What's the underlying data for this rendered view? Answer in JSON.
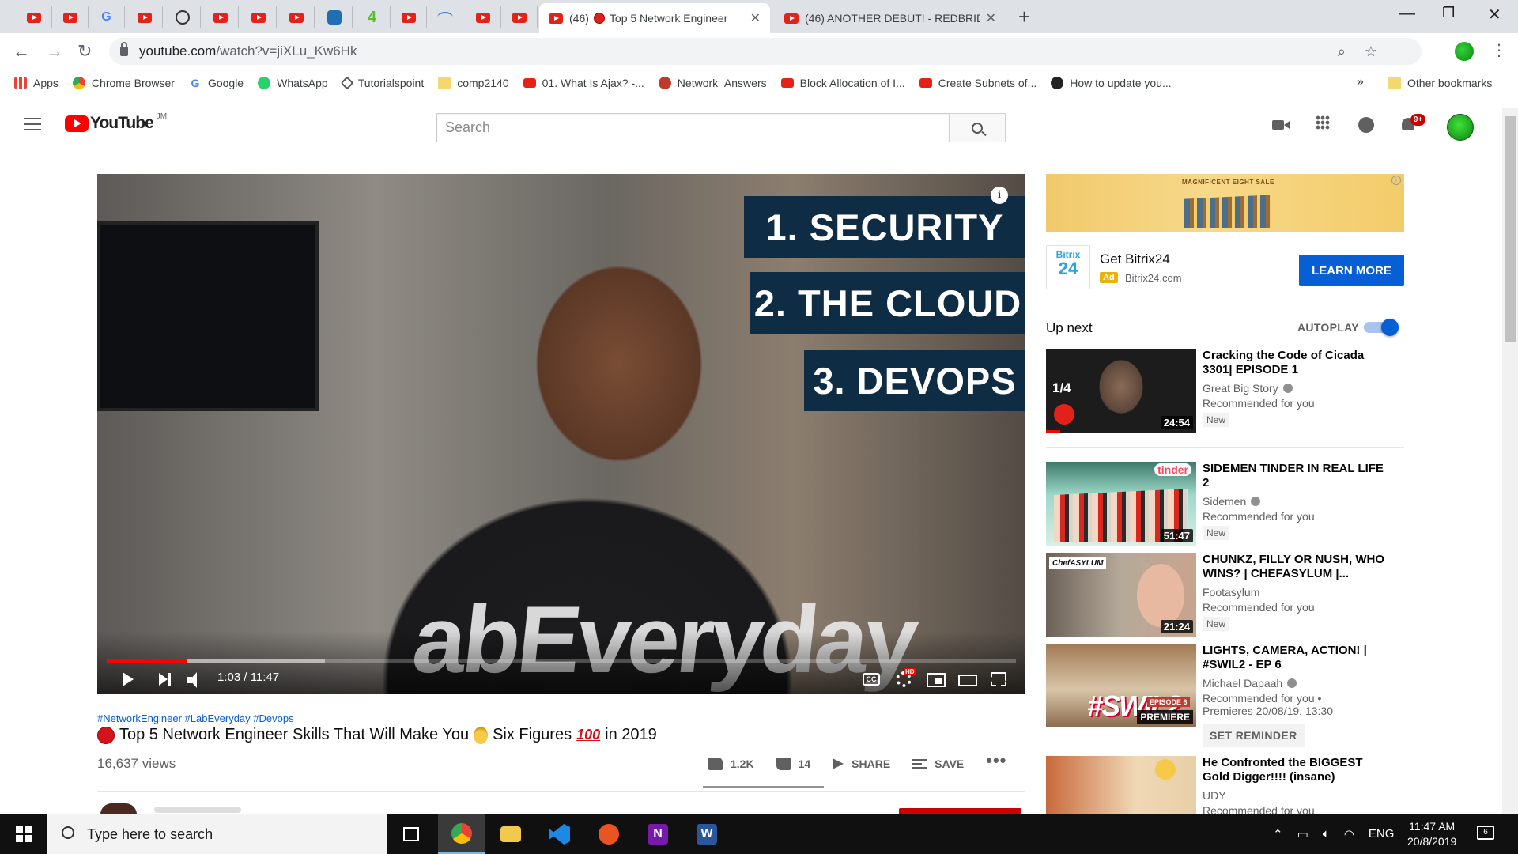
{
  "browser": {
    "mini_tab_icons": [
      "youtube-icon",
      "youtube-icon",
      "google-icon",
      "youtube-icon",
      "circle-m-icon",
      "youtube-icon",
      "youtube-icon",
      "youtube-icon",
      "blue-wave-icon",
      "number-4-icon",
      "youtube-icon",
      "globe-icon",
      "youtube-icon",
      "youtube-icon"
    ],
    "active_tab": {
      "count": "(46)",
      "title": "Top 5 Network Engineer"
    },
    "second_tab": {
      "title": "(46) ANOTHER DEBUT! - REDBRID"
    },
    "url_domain": "youtube.com",
    "url_path": "/watch?v=jiXLu_Kw6Hk",
    "bookmarks": [
      {
        "icon": "apps",
        "label": "Apps"
      },
      {
        "icon": "chrome",
        "label": "Chrome Browser"
      },
      {
        "icon": "google",
        "label": "Google"
      },
      {
        "icon": "wa",
        "label": "WhatsApp"
      },
      {
        "icon": "tp",
        "label": "Tutorialspoint"
      },
      {
        "icon": "folder",
        "label": "comp2140"
      },
      {
        "icon": "yt",
        "label": "01. What Is Ajax? -..."
      },
      {
        "icon": "net",
        "label": "Network_Answers"
      },
      {
        "icon": "yt",
        "label": "Block Allocation of I..."
      },
      {
        "icon": "yt",
        "label": "Create Subnets of..."
      },
      {
        "icon": "ea",
        "label": "How to update you..."
      }
    ],
    "bookmarks_more": "»",
    "other_bookmarks": "Other bookmarks"
  },
  "youtube": {
    "logo_text": "YouTube",
    "logo_country": "JM",
    "search_placeholder": "Search",
    "notification_badge": "9+"
  },
  "player": {
    "overlay_1": "1. SECURITY",
    "overlay_2": "2. THE CLOUD",
    "overlay_3": "3. DEVOPS",
    "shirt_text": "abEveryday",
    "time": "1:03 / 11:47",
    "played_fraction": 0.089,
    "buffered_fraction": 0.24,
    "cc_label": "CC",
    "hd_label": "HD"
  },
  "video": {
    "tags": "#NetworkEngineer #LabEveryday #Devops",
    "title_part1": "Top 5 Network Engineer Skills That Will Make You",
    "title_part2": "Six Figures",
    "title_part3": "in 2019",
    "hundred_emoji": "100",
    "views": "16,637 views",
    "likes": "1.2K",
    "dislikes": "14",
    "share": "SHARE",
    "save": "SAVE",
    "more": "•••"
  },
  "ad": {
    "banner_text": "MAGNIFICENT EIGHT SALE",
    "logo_line1": "Bitrix",
    "logo_line2": "24",
    "title": "Get Bitrix24",
    "tag": "Ad",
    "domain": "Bitrix24.com",
    "button": "LEARN MORE"
  },
  "sidebar": {
    "up_next": "Up next",
    "autoplay": "AUTOPLAY",
    "videos": [
      {
        "title": "Cracking the Code of Cicada 3301| EPISODE 1",
        "channel": "Great Big Story",
        "rec": "Recommended for you",
        "badge": "New",
        "duration": "24:54",
        "overlay": "1/4"
      },
      {
        "title": "SIDEMEN TINDER IN REAL LIFE 2",
        "channel": "Sidemen",
        "rec": "Recommended for you",
        "badge": "New",
        "duration": "51:47",
        "overlay": "tinder"
      },
      {
        "title": "CHUNKZ, FILLY OR NUSH, WHO WINS? | CHEFASYLUM |...",
        "channel": "Footasylum",
        "rec": "Recommended for you",
        "badge": "New",
        "duration": "21:24",
        "overlay": "ChefASYLUM"
      },
      {
        "title": "LIGHTS, CAMERA, ACTION! | #SWIL2 - EP 6",
        "channel": "Michael Dapaah",
        "rec": "Recommended for you •",
        "premiere": "Premieres 20/08/19, 13:30",
        "reminder": "SET REMINDER",
        "overlay": "#SWIL2",
        "ep": "EPISODE 6",
        "premiere_badge": "PREMIERE"
      },
      {
        "title": "He Confronted the BIGGEST Gold Digger!!!! (insane)",
        "channel": "UDY",
        "rec": "Recommended for you"
      }
    ]
  },
  "taskbar": {
    "search_text": "Type here to search",
    "lang": "ENG",
    "time": "11:47 AM",
    "date": "20/8/2019",
    "notification_count": "6"
  }
}
